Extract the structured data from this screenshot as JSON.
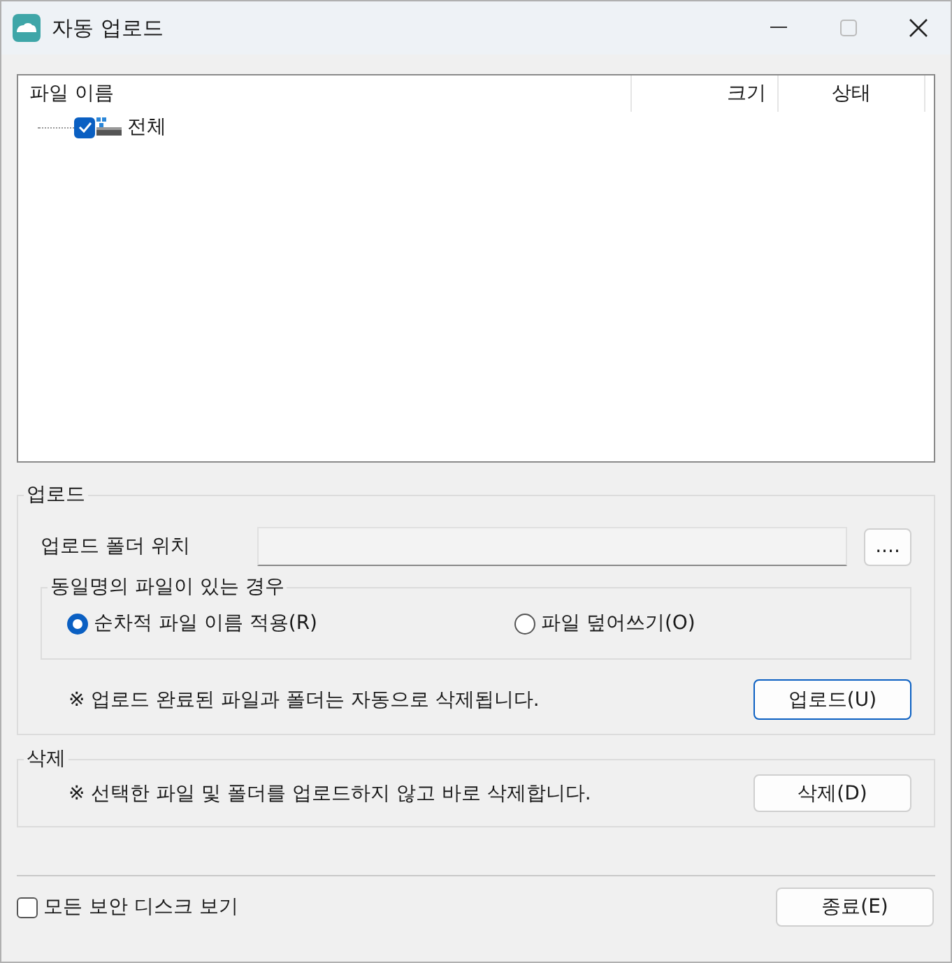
{
  "window": {
    "title": "자동 업로드"
  },
  "file_list": {
    "columns": [
      "파일 이름",
      "크기",
      "상태"
    ],
    "items": [
      {
        "label": "전체",
        "checked": true
      }
    ]
  },
  "upload": {
    "title": "업로드",
    "folder_label": "업로드 폴더 위치",
    "browse_button": "....",
    "duplicate_group": {
      "title": "동일명의 파일이 있는 경우",
      "options": [
        {
          "label": "순차적 파일 이름 적용(R)",
          "selected": true
        },
        {
          "label": "파일 덮어쓰기(O)",
          "selected": false
        }
      ]
    },
    "note": "※ 업로드 완료된 파일과 폴더는 자동으로 삭제됩니다.",
    "button": "업로드(U)"
  },
  "delete": {
    "title": "삭제",
    "note": "※ 선택한 파일 및 폴더를 업로드하지 않고 바로 삭제합니다.",
    "button": "삭제(D)"
  },
  "footer": {
    "checkbox": {
      "label": "모든 보안 디스크 보기",
      "checked": false
    },
    "button": "종료(E)"
  }
}
